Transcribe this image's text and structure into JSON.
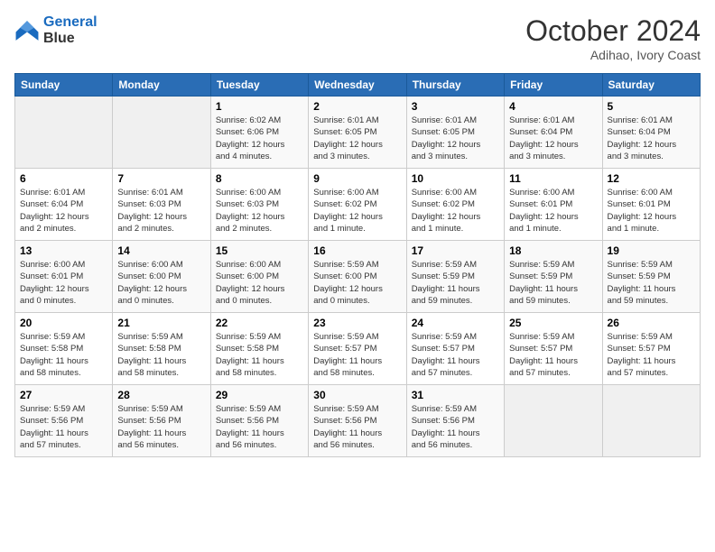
{
  "logo": {
    "line1": "General",
    "line2": "Blue"
  },
  "title": "October 2024",
  "subtitle": "Adihao, Ivory Coast",
  "weekdays": [
    "Sunday",
    "Monday",
    "Tuesday",
    "Wednesday",
    "Thursday",
    "Friday",
    "Saturday"
  ],
  "weeks": [
    [
      {
        "day": "",
        "info": ""
      },
      {
        "day": "",
        "info": ""
      },
      {
        "day": "1",
        "info": "Sunrise: 6:02 AM\nSunset: 6:06 PM\nDaylight: 12 hours\nand 4 minutes."
      },
      {
        "day": "2",
        "info": "Sunrise: 6:01 AM\nSunset: 6:05 PM\nDaylight: 12 hours\nand 3 minutes."
      },
      {
        "day": "3",
        "info": "Sunrise: 6:01 AM\nSunset: 6:05 PM\nDaylight: 12 hours\nand 3 minutes."
      },
      {
        "day": "4",
        "info": "Sunrise: 6:01 AM\nSunset: 6:04 PM\nDaylight: 12 hours\nand 3 minutes."
      },
      {
        "day": "5",
        "info": "Sunrise: 6:01 AM\nSunset: 6:04 PM\nDaylight: 12 hours\nand 3 minutes."
      }
    ],
    [
      {
        "day": "6",
        "info": "Sunrise: 6:01 AM\nSunset: 6:04 PM\nDaylight: 12 hours\nand 2 minutes."
      },
      {
        "day": "7",
        "info": "Sunrise: 6:01 AM\nSunset: 6:03 PM\nDaylight: 12 hours\nand 2 minutes."
      },
      {
        "day": "8",
        "info": "Sunrise: 6:00 AM\nSunset: 6:03 PM\nDaylight: 12 hours\nand 2 minutes."
      },
      {
        "day": "9",
        "info": "Sunrise: 6:00 AM\nSunset: 6:02 PM\nDaylight: 12 hours\nand 1 minute."
      },
      {
        "day": "10",
        "info": "Sunrise: 6:00 AM\nSunset: 6:02 PM\nDaylight: 12 hours\nand 1 minute."
      },
      {
        "day": "11",
        "info": "Sunrise: 6:00 AM\nSunset: 6:01 PM\nDaylight: 12 hours\nand 1 minute."
      },
      {
        "day": "12",
        "info": "Sunrise: 6:00 AM\nSunset: 6:01 PM\nDaylight: 12 hours\nand 1 minute."
      }
    ],
    [
      {
        "day": "13",
        "info": "Sunrise: 6:00 AM\nSunset: 6:01 PM\nDaylight: 12 hours\nand 0 minutes."
      },
      {
        "day": "14",
        "info": "Sunrise: 6:00 AM\nSunset: 6:00 PM\nDaylight: 12 hours\nand 0 minutes."
      },
      {
        "day": "15",
        "info": "Sunrise: 6:00 AM\nSunset: 6:00 PM\nDaylight: 12 hours\nand 0 minutes."
      },
      {
        "day": "16",
        "info": "Sunrise: 5:59 AM\nSunset: 6:00 PM\nDaylight: 12 hours\nand 0 minutes."
      },
      {
        "day": "17",
        "info": "Sunrise: 5:59 AM\nSunset: 5:59 PM\nDaylight: 11 hours\nand 59 minutes."
      },
      {
        "day": "18",
        "info": "Sunrise: 5:59 AM\nSunset: 5:59 PM\nDaylight: 11 hours\nand 59 minutes."
      },
      {
        "day": "19",
        "info": "Sunrise: 5:59 AM\nSunset: 5:59 PM\nDaylight: 11 hours\nand 59 minutes."
      }
    ],
    [
      {
        "day": "20",
        "info": "Sunrise: 5:59 AM\nSunset: 5:58 PM\nDaylight: 11 hours\nand 58 minutes."
      },
      {
        "day": "21",
        "info": "Sunrise: 5:59 AM\nSunset: 5:58 PM\nDaylight: 11 hours\nand 58 minutes."
      },
      {
        "day": "22",
        "info": "Sunrise: 5:59 AM\nSunset: 5:58 PM\nDaylight: 11 hours\nand 58 minutes."
      },
      {
        "day": "23",
        "info": "Sunrise: 5:59 AM\nSunset: 5:57 PM\nDaylight: 11 hours\nand 58 minutes."
      },
      {
        "day": "24",
        "info": "Sunrise: 5:59 AM\nSunset: 5:57 PM\nDaylight: 11 hours\nand 57 minutes."
      },
      {
        "day": "25",
        "info": "Sunrise: 5:59 AM\nSunset: 5:57 PM\nDaylight: 11 hours\nand 57 minutes."
      },
      {
        "day": "26",
        "info": "Sunrise: 5:59 AM\nSunset: 5:57 PM\nDaylight: 11 hours\nand 57 minutes."
      }
    ],
    [
      {
        "day": "27",
        "info": "Sunrise: 5:59 AM\nSunset: 5:56 PM\nDaylight: 11 hours\nand 57 minutes."
      },
      {
        "day": "28",
        "info": "Sunrise: 5:59 AM\nSunset: 5:56 PM\nDaylight: 11 hours\nand 56 minutes."
      },
      {
        "day": "29",
        "info": "Sunrise: 5:59 AM\nSunset: 5:56 PM\nDaylight: 11 hours\nand 56 minutes."
      },
      {
        "day": "30",
        "info": "Sunrise: 5:59 AM\nSunset: 5:56 PM\nDaylight: 11 hours\nand 56 minutes."
      },
      {
        "day": "31",
        "info": "Sunrise: 5:59 AM\nSunset: 5:56 PM\nDaylight: 11 hours\nand 56 minutes."
      },
      {
        "day": "",
        "info": ""
      },
      {
        "day": "",
        "info": ""
      }
    ]
  ]
}
